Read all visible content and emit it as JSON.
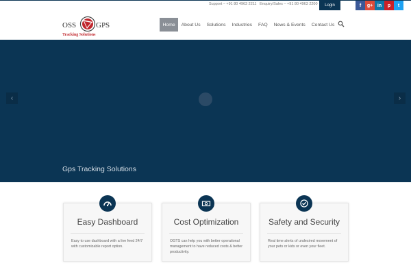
{
  "topbar": {
    "support": "Support – +91 80 4963 2211",
    "enquiry": "Enquiry/Sales – +91 80 4963 2200",
    "login": "Login",
    "socials": [
      {
        "icon": "facebook-icon",
        "glyph": "f",
        "color": "#3b5998"
      },
      {
        "icon": "google-plus-icon",
        "glyph": "g+",
        "color": "#dd4b39"
      },
      {
        "icon": "linkedin-icon",
        "glyph": "in",
        "color": "#0e76a8"
      },
      {
        "icon": "pinterest-icon",
        "glyph": "p",
        "color": "#cb2027"
      },
      {
        "icon": "twitter-icon",
        "glyph": "t",
        "color": "#1da1f2"
      }
    ]
  },
  "logo": {
    "left_word": "OSS",
    "right_word": "GPS",
    "tagline": "Tracking Solutions"
  },
  "nav": {
    "items": [
      "Home",
      "About Us",
      "Solutions",
      "Industries",
      "FAQ",
      "News & Events",
      "Contact Us"
    ],
    "active": "Home"
  },
  "hero": {
    "caption": "Gps Tracking Solutions",
    "prev": "‹",
    "next": "›",
    "background": "#0b3554"
  },
  "features": [
    {
      "icon": "dashboard-icon",
      "title": "Easy Dashboard",
      "description": "Easy to use dashboard with a live feed 24/7 with customizable report option."
    },
    {
      "icon": "money-icon",
      "title": "Cost Optimization",
      "description": "OGTS can help you with better operational management to have reduced costs & better productivity."
    },
    {
      "icon": "check-circle-icon",
      "title": "Safety and Security",
      "description": "Real time alerts of undesired movement of your pets or kids or even your fleet."
    }
  ]
}
